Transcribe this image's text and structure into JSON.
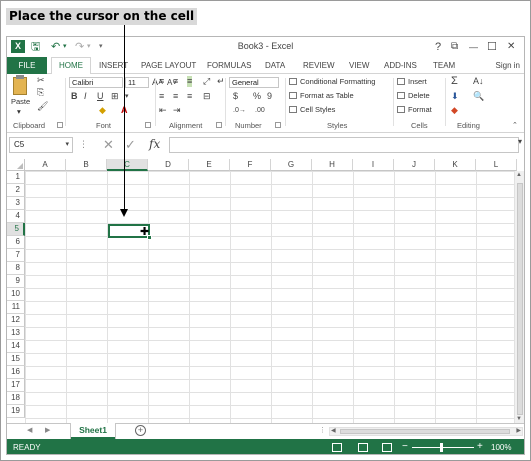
{
  "callout": {
    "text": "Place the cursor on the cell"
  },
  "window": {
    "title": "Book3 - Excel",
    "app_icon": "X"
  },
  "quick_access": {
    "save_icon": "save-icon",
    "undo_icon": "undo-icon",
    "redo_icon": "redo-icon",
    "customize_icon": "customize-quick-access-icon"
  },
  "window_controls": {
    "help": "?",
    "ribbon_options": "⧉",
    "minimize": "—",
    "maximize": "☐",
    "close": "✕"
  },
  "ribbon_tabs": [
    "FILE",
    "HOME",
    "INSERT",
    "PAGE LAYOUT",
    "FORMULAS",
    "DATA",
    "REVIEW",
    "VIEW",
    "ADD-INS",
    "TEAM"
  ],
  "signin": "Sign in",
  "ribbon": {
    "clipboard": {
      "paste": "Paste",
      "label": "Clipboard"
    },
    "font": {
      "name": "Calibri",
      "size": "11",
      "bold": "B",
      "italic": "I",
      "underline": "U",
      "label": "Font"
    },
    "alignment": {
      "label": "Alignment"
    },
    "number": {
      "format": "General",
      "currency": "$",
      "percent": "%",
      "comma": "9",
      "label": "Number"
    },
    "styles": {
      "conditional": "Conditional Formatting",
      "table": "Format as Table",
      "cell_styles": "Cell Styles",
      "label": "Styles"
    },
    "cells": {
      "insert": "Insert",
      "delete": "Delete",
      "format": "Format",
      "label": "Cells"
    },
    "editing": {
      "sum": "Σ",
      "label": "Editing"
    }
  },
  "formula_bar": {
    "name_box": "C5",
    "fx": "fx",
    "cancel": "✕",
    "enter": "✓",
    "value": ""
  },
  "grid": {
    "columns": [
      "A",
      "B",
      "C",
      "D",
      "E",
      "F",
      "G",
      "H",
      "I",
      "J",
      "K",
      "L"
    ],
    "rows": [
      "1",
      "2",
      "3",
      "4",
      "5",
      "6",
      "7",
      "8",
      "9",
      "10",
      "11",
      "12",
      "13",
      "14",
      "15",
      "16",
      "17",
      "18",
      "19"
    ],
    "active_cell": "C5",
    "active_column": "C",
    "active_row": "5"
  },
  "sheets": {
    "tabs": [
      "Sheet1"
    ],
    "add_label": "+"
  },
  "status": {
    "ready": "READY",
    "zoom": "100%",
    "zoom_minus": "−",
    "zoom_plus": "+"
  },
  "colors": {
    "accent": "#217346",
    "callout_bg": "#d9d9d9"
  }
}
